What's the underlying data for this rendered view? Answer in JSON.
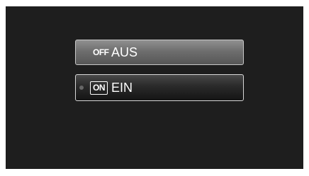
{
  "menu": {
    "options": [
      {
        "badge": "OFF",
        "label": "AUS",
        "icon": "off-icon",
        "selected": false
      },
      {
        "badge": "ON",
        "label": "EIN",
        "icon": "on-icon",
        "selected": true
      }
    ]
  },
  "colors": {
    "screen_bg": "#1e1e1e",
    "option_border": "#c8c8c8"
  }
}
